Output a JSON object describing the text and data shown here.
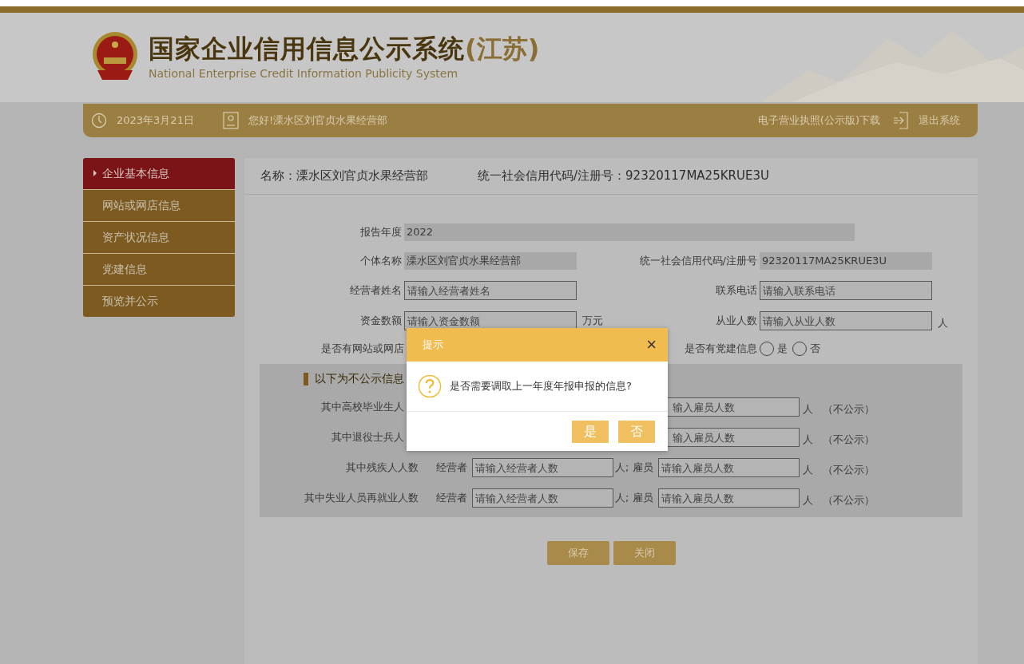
{
  "header": {
    "title": "国家企业信用信息公示系统",
    "region": "(江苏)",
    "subtitle": "National Enterprise Credit Information Publicity System"
  },
  "nav": {
    "date": "2023年3月21日",
    "greeting": "您好!溧水区刘官贞水果经营部",
    "download_link": "电子营业执照(公示版)下载",
    "logout": "退出系统"
  },
  "sidebar": [
    {
      "label": "企业基本信息",
      "selected": true
    },
    {
      "label": "网站或网店信息",
      "selected": false
    },
    {
      "label": "资产状况信息",
      "selected": false
    },
    {
      "label": "党建信息",
      "selected": false
    },
    {
      "label": "预览并公示",
      "selected": false
    }
  ],
  "panel": {
    "name": "名称：溧水区刘官贞水果经营部",
    "code": "统一社会信用代码/注册号：92320117MA25KRUE3U"
  },
  "form": {
    "year": {
      "label": "报告年度",
      "value": "2022"
    },
    "individual_name": {
      "label": "个体名称",
      "value": "溧水区刘官贞水果经营部"
    },
    "credit_code": {
      "label": "统一社会信用代码/注册号",
      "value": "92320117MA25KRUE3U"
    },
    "operator_name": {
      "label": "经营者姓名",
      "placeholder": "请输入经营者姓名"
    },
    "phone": {
      "label": "联系电话",
      "placeholder": "请输入联系电话"
    },
    "capital": {
      "label": "资金数额",
      "placeholder": "请输入资金数额",
      "unit": "万元"
    },
    "employees": {
      "label": "从业人数",
      "placeholder": "请输入从业人数",
      "unit": "人"
    },
    "has_website": {
      "label": "是否有网站或网店"
    },
    "has_party": {
      "label": "是否有党建信息",
      "options": [
        {
          "label": "是",
          "selected": false
        },
        {
          "label": "否",
          "selected": false
        }
      ]
    }
  },
  "non_public": {
    "heading": "以下为不公示信息",
    "rows": [
      {
        "label": "其中高校毕业生人",
        "employee_placeholder": "输入雇员人数",
        "unit": "人",
        "note": "（不公示）"
      },
      {
        "label": "其中退役士兵人",
        "employee_placeholder": "输入雇员人数",
        "unit": "人",
        "note": "（不公示）"
      },
      {
        "label": "其中残疾人人数",
        "operator_label": "经营者",
        "operator_placeholder": "请输入经营者人数",
        "mid": "人; 雇员",
        "employee_placeholder": "请输入雇员人数",
        "unit": "人",
        "note": "（不公示）"
      },
      {
        "label": "其中失业人员再就业人数",
        "operator_label": "经营者",
        "operator_placeholder": "请输入经营者人数",
        "mid": "人; 雇员",
        "employee_placeholder": "请输入雇员人数",
        "unit": "人",
        "note": "（不公示）"
      }
    ]
  },
  "actions": [
    {
      "label": "保存"
    },
    {
      "label": "关闭"
    }
  ],
  "dialog": {
    "title": "提示",
    "close": "×",
    "message": "是否需要调取上一年度年报申报的信息?",
    "buttons": [
      "是",
      "否"
    ]
  }
}
